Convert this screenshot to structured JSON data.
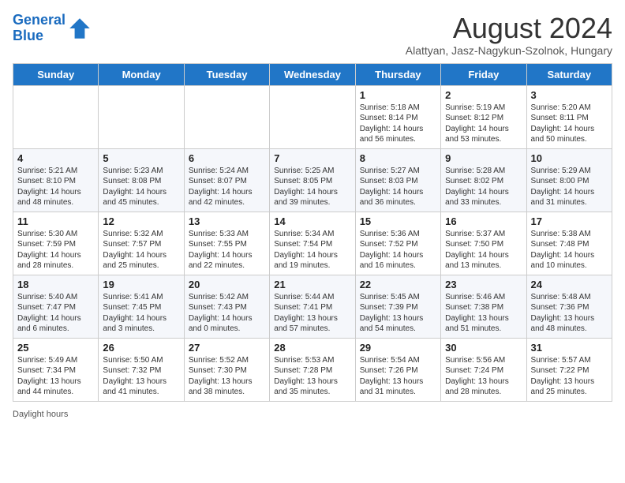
{
  "header": {
    "logo_line1": "General",
    "logo_line2": "Blue",
    "month_title": "August 2024",
    "subtitle": "Alattyan, Jasz-Nagykun-Szolnok, Hungary"
  },
  "weekdays": [
    "Sunday",
    "Monday",
    "Tuesday",
    "Wednesday",
    "Thursday",
    "Friday",
    "Saturday"
  ],
  "weeks": [
    [
      {
        "day": "",
        "info": ""
      },
      {
        "day": "",
        "info": ""
      },
      {
        "day": "",
        "info": ""
      },
      {
        "day": "",
        "info": ""
      },
      {
        "day": "1",
        "info": "Sunrise: 5:18 AM\nSunset: 8:14 PM\nDaylight: 14 hours\nand 56 minutes."
      },
      {
        "day": "2",
        "info": "Sunrise: 5:19 AM\nSunset: 8:12 PM\nDaylight: 14 hours\nand 53 minutes."
      },
      {
        "day": "3",
        "info": "Sunrise: 5:20 AM\nSunset: 8:11 PM\nDaylight: 14 hours\nand 50 minutes."
      }
    ],
    [
      {
        "day": "4",
        "info": "Sunrise: 5:21 AM\nSunset: 8:10 PM\nDaylight: 14 hours\nand 48 minutes."
      },
      {
        "day": "5",
        "info": "Sunrise: 5:23 AM\nSunset: 8:08 PM\nDaylight: 14 hours\nand 45 minutes."
      },
      {
        "day": "6",
        "info": "Sunrise: 5:24 AM\nSunset: 8:07 PM\nDaylight: 14 hours\nand 42 minutes."
      },
      {
        "day": "7",
        "info": "Sunrise: 5:25 AM\nSunset: 8:05 PM\nDaylight: 14 hours\nand 39 minutes."
      },
      {
        "day": "8",
        "info": "Sunrise: 5:27 AM\nSunset: 8:03 PM\nDaylight: 14 hours\nand 36 minutes."
      },
      {
        "day": "9",
        "info": "Sunrise: 5:28 AM\nSunset: 8:02 PM\nDaylight: 14 hours\nand 33 minutes."
      },
      {
        "day": "10",
        "info": "Sunrise: 5:29 AM\nSunset: 8:00 PM\nDaylight: 14 hours\nand 31 minutes."
      }
    ],
    [
      {
        "day": "11",
        "info": "Sunrise: 5:30 AM\nSunset: 7:59 PM\nDaylight: 14 hours\nand 28 minutes."
      },
      {
        "day": "12",
        "info": "Sunrise: 5:32 AM\nSunset: 7:57 PM\nDaylight: 14 hours\nand 25 minutes."
      },
      {
        "day": "13",
        "info": "Sunrise: 5:33 AM\nSunset: 7:55 PM\nDaylight: 14 hours\nand 22 minutes."
      },
      {
        "day": "14",
        "info": "Sunrise: 5:34 AM\nSunset: 7:54 PM\nDaylight: 14 hours\nand 19 minutes."
      },
      {
        "day": "15",
        "info": "Sunrise: 5:36 AM\nSunset: 7:52 PM\nDaylight: 14 hours\nand 16 minutes."
      },
      {
        "day": "16",
        "info": "Sunrise: 5:37 AM\nSunset: 7:50 PM\nDaylight: 14 hours\nand 13 minutes."
      },
      {
        "day": "17",
        "info": "Sunrise: 5:38 AM\nSunset: 7:48 PM\nDaylight: 14 hours\nand 10 minutes."
      }
    ],
    [
      {
        "day": "18",
        "info": "Sunrise: 5:40 AM\nSunset: 7:47 PM\nDaylight: 14 hours\nand 6 minutes."
      },
      {
        "day": "19",
        "info": "Sunrise: 5:41 AM\nSunset: 7:45 PM\nDaylight: 14 hours\nand 3 minutes."
      },
      {
        "day": "20",
        "info": "Sunrise: 5:42 AM\nSunset: 7:43 PM\nDaylight: 14 hours\nand 0 minutes."
      },
      {
        "day": "21",
        "info": "Sunrise: 5:44 AM\nSunset: 7:41 PM\nDaylight: 13 hours\nand 57 minutes."
      },
      {
        "day": "22",
        "info": "Sunrise: 5:45 AM\nSunset: 7:39 PM\nDaylight: 13 hours\nand 54 minutes."
      },
      {
        "day": "23",
        "info": "Sunrise: 5:46 AM\nSunset: 7:38 PM\nDaylight: 13 hours\nand 51 minutes."
      },
      {
        "day": "24",
        "info": "Sunrise: 5:48 AM\nSunset: 7:36 PM\nDaylight: 13 hours\nand 48 minutes."
      }
    ],
    [
      {
        "day": "25",
        "info": "Sunrise: 5:49 AM\nSunset: 7:34 PM\nDaylight: 13 hours\nand 44 minutes."
      },
      {
        "day": "26",
        "info": "Sunrise: 5:50 AM\nSunset: 7:32 PM\nDaylight: 13 hours\nand 41 minutes."
      },
      {
        "day": "27",
        "info": "Sunrise: 5:52 AM\nSunset: 7:30 PM\nDaylight: 13 hours\nand 38 minutes."
      },
      {
        "day": "28",
        "info": "Sunrise: 5:53 AM\nSunset: 7:28 PM\nDaylight: 13 hours\nand 35 minutes."
      },
      {
        "day": "29",
        "info": "Sunrise: 5:54 AM\nSunset: 7:26 PM\nDaylight: 13 hours\nand 31 minutes."
      },
      {
        "day": "30",
        "info": "Sunrise: 5:56 AM\nSunset: 7:24 PM\nDaylight: 13 hours\nand 28 minutes."
      },
      {
        "day": "31",
        "info": "Sunrise: 5:57 AM\nSunset: 7:22 PM\nDaylight: 13 hours\nand 25 minutes."
      }
    ]
  ],
  "footer": {
    "daylight_label": "Daylight hours"
  }
}
